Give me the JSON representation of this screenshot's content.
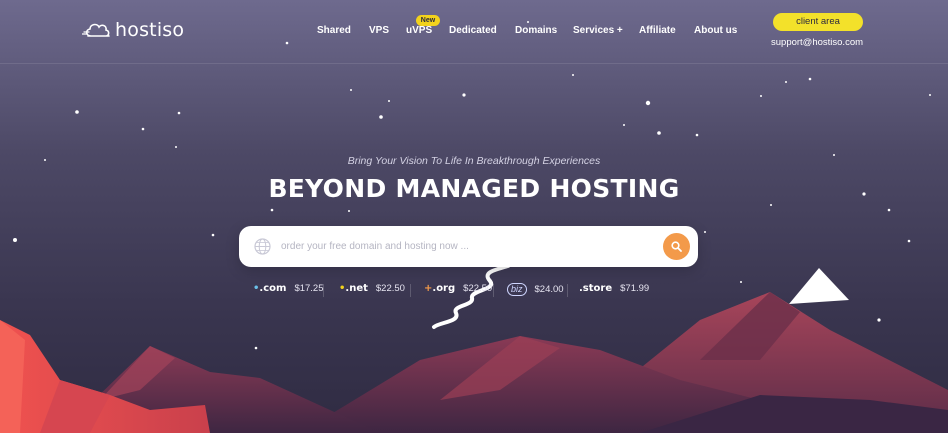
{
  "brand": {
    "name": "hostiso",
    "logo_icon": "cloud-icon"
  },
  "nav": {
    "items": [
      "Shared",
      "VPS",
      "uVPS",
      "Dedicated",
      "Domains",
      "Services +",
      "Affiliate",
      "About us"
    ],
    "new_badge": "New"
  },
  "header": {
    "client_area": "client area",
    "support_email": "support@hostiso.com"
  },
  "hero": {
    "tagline": "Bring Your Vision To Life In Breakthrough Experiences",
    "title": "BEYOND MANAGED HOSTING"
  },
  "search": {
    "placeholder": "order your free domain and hosting now ...",
    "value": "",
    "left_icon": "globe-icon",
    "button_icon": "search-icon"
  },
  "tlds": [
    {
      "name": ".com",
      "price": "$17.25"
    },
    {
      "name": ".net",
      "price": "$22.50"
    },
    {
      "name": ".org",
      "price": "$22.50"
    },
    {
      "name": "biz",
      "price": "$24.00"
    },
    {
      "name": ".store",
      "price": "$71.99"
    }
  ],
  "colors": {
    "accent_yellow": "#f3e12a",
    "search_button": "#f39a4a",
    "mountain_red": "#f0524f",
    "mountain_dark": "#7d3a52",
    "background_top": "#6e6a8e",
    "background_bottom": "#2f2b42"
  }
}
